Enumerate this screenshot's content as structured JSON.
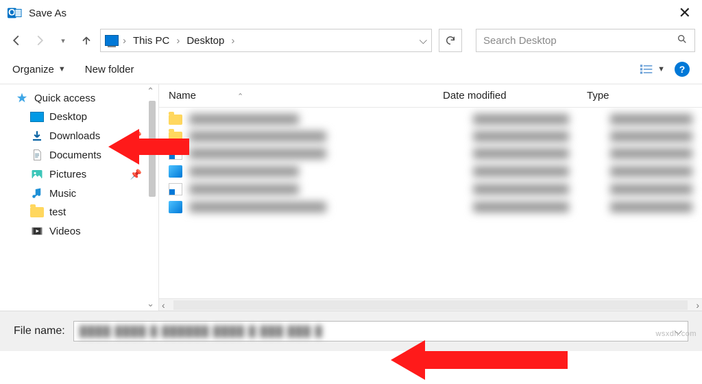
{
  "window": {
    "title": "Save As",
    "close": "✕"
  },
  "nav": {
    "breadcrumbs": [
      "This PC",
      "Desktop"
    ],
    "search_placeholder": "Search Desktop"
  },
  "toolbar": {
    "organize": "Organize",
    "newfolder": "New folder"
  },
  "sidebar": {
    "quick": "Quick access",
    "items": [
      {
        "label": "Desktop",
        "kind": "desk",
        "pinned": true
      },
      {
        "label": "Downloads",
        "kind": "down",
        "pinned": true
      },
      {
        "label": "Documents",
        "kind": "doc",
        "pinned": true
      },
      {
        "label": "Pictures",
        "kind": "pic",
        "pinned": true
      },
      {
        "label": "Music",
        "kind": "music",
        "pinned": false
      },
      {
        "label": "test",
        "kind": "folder",
        "pinned": false
      },
      {
        "label": "Videos",
        "kind": "vid",
        "pinned": false
      }
    ]
  },
  "columns": {
    "name": "Name",
    "date": "Date modified",
    "type": "Type"
  },
  "footer": {
    "label": "File name:"
  },
  "watermark": "wsxdn.com"
}
